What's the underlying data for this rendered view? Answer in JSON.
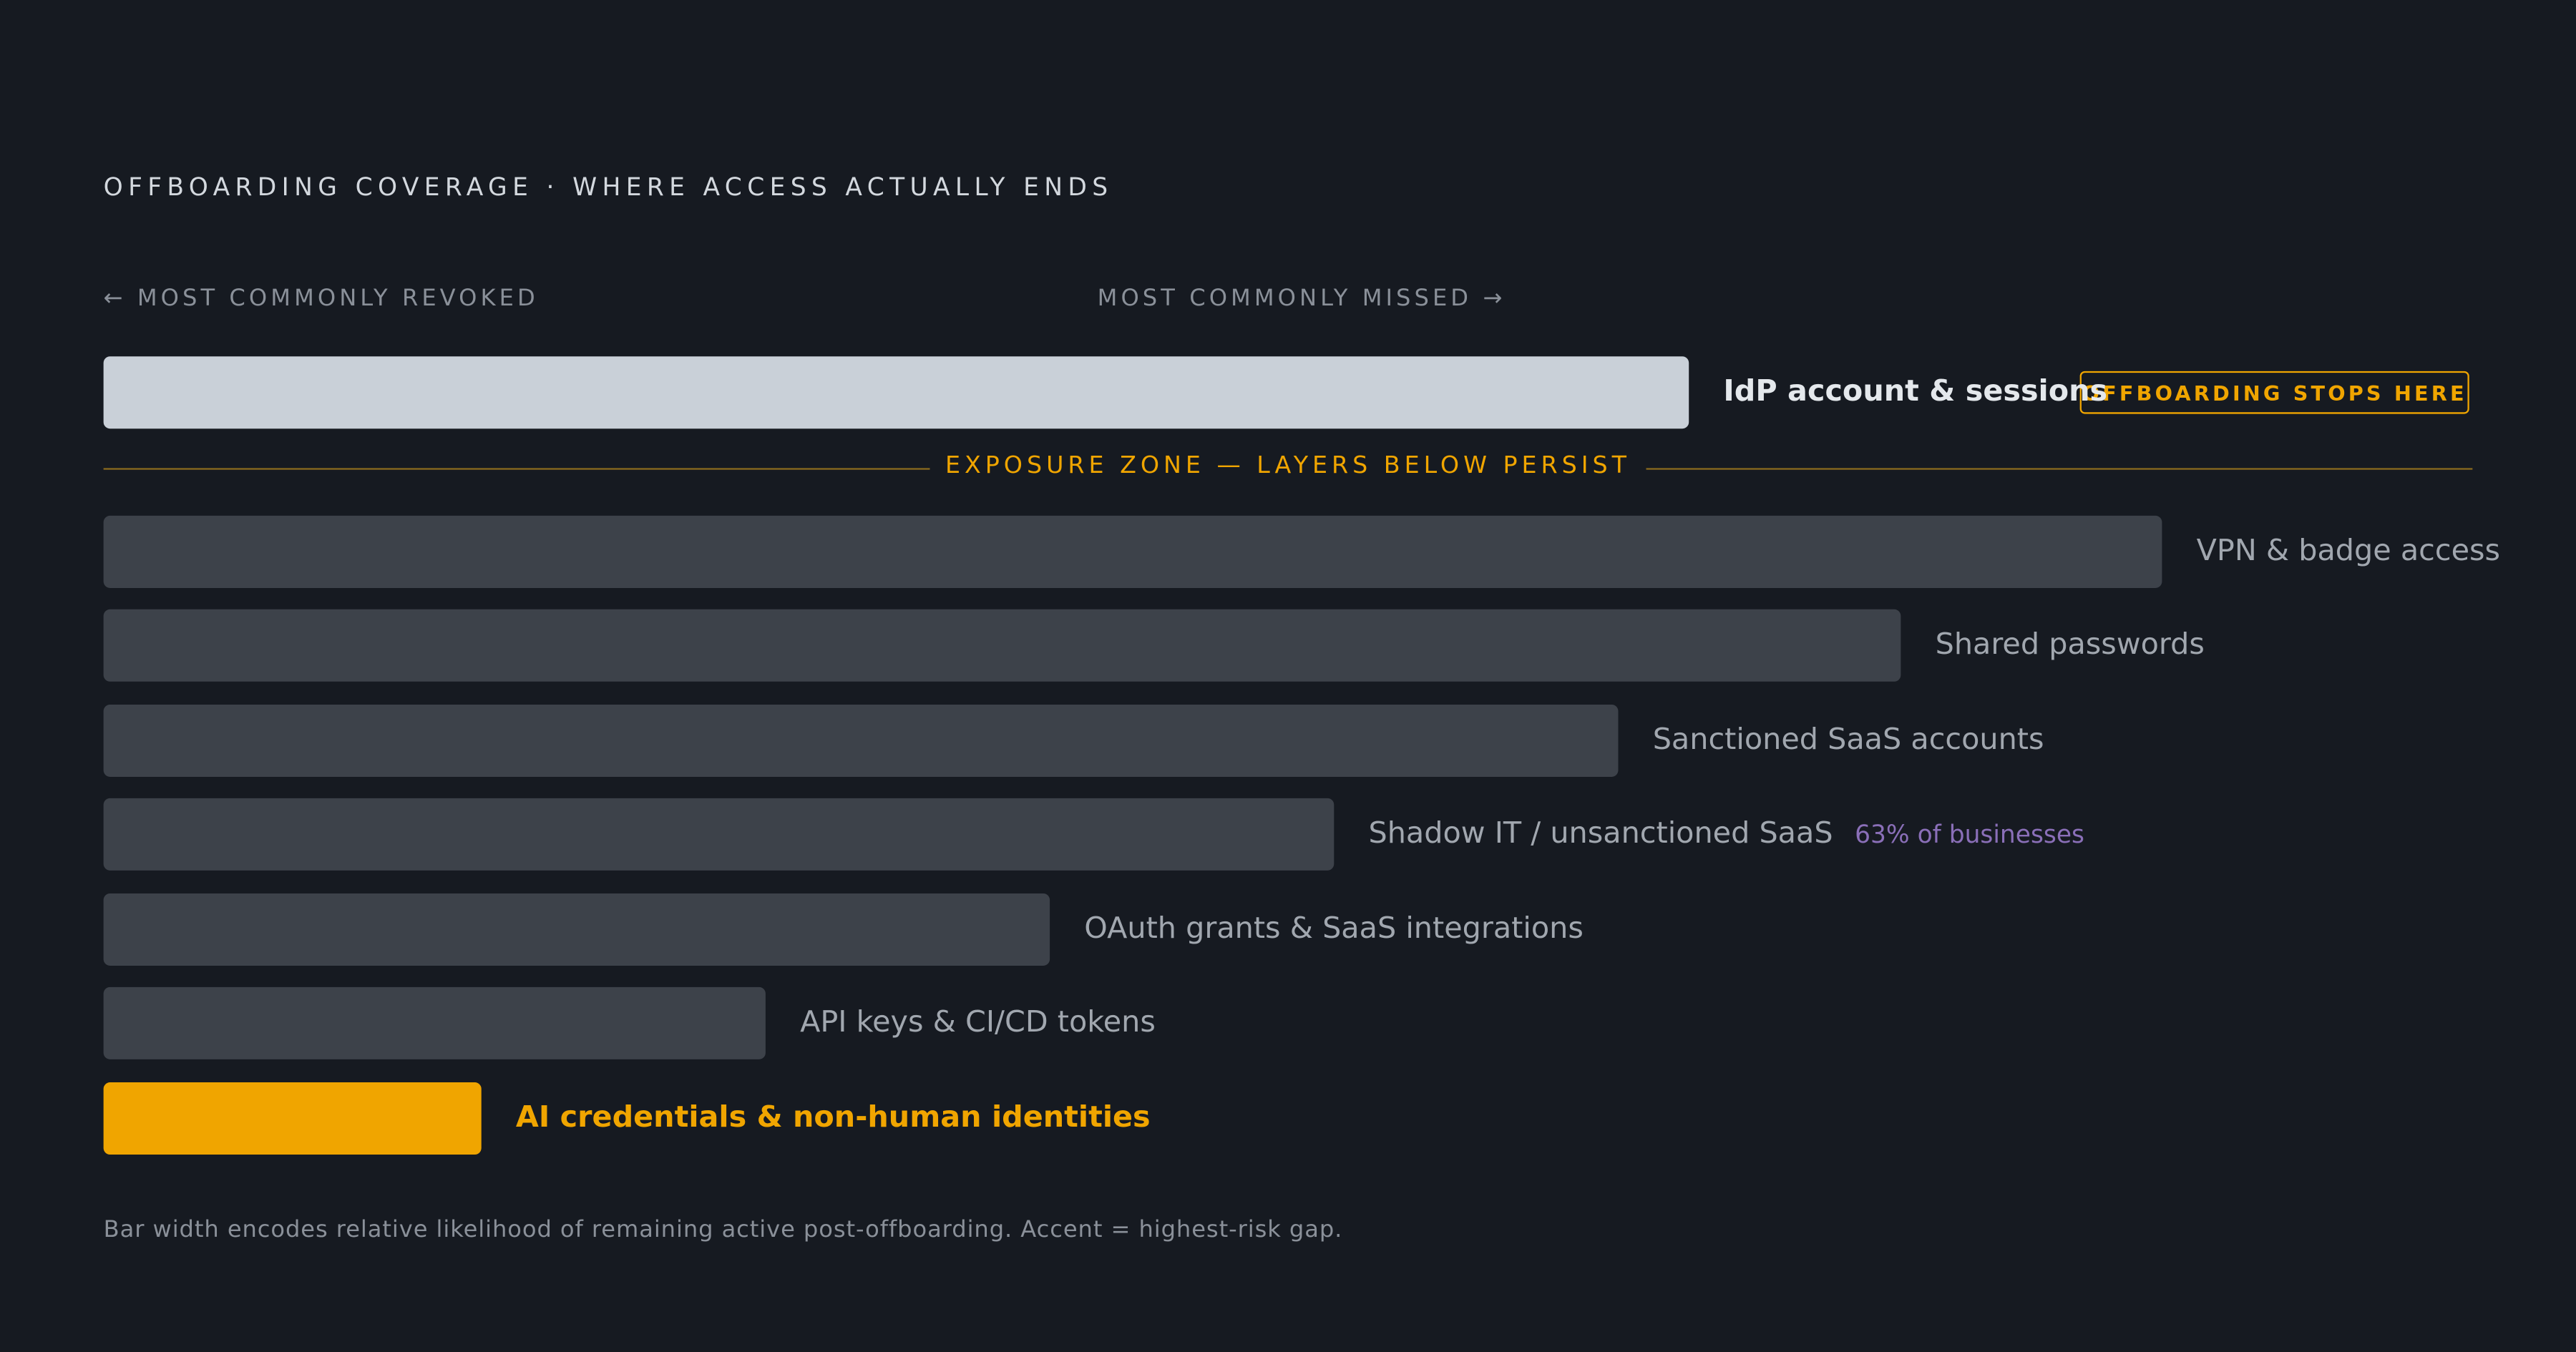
{
  "title": "OFFBOARDING COVERAGE · WHERE ACCESS ACTUALLY ENDS",
  "direction": {
    "left": "← MOST COMMONLY REVOKED",
    "right": "MOST COMMONLY MISSED →"
  },
  "badge": "OFFBOARDING STOPS HERE",
  "zone_label": "EXPOSURE ZONE — LAYERS BELOW PERSIST",
  "footnote": "Bar width encodes relative likelihood of remaining active post-offboarding. Accent = highest-risk gap.",
  "colors": {
    "background": "#161a21",
    "primary_bar": "#c9d0d8",
    "muted_bar": "#3d424a",
    "accent": "#f0a500",
    "note": "#8a6fb8"
  },
  "chart_data": {
    "type": "bar",
    "orientation": "horizontal",
    "categories": [
      "IdP account & sessions",
      "VPN & badge access",
      "Shared passwords",
      "Sanctioned SaaS accounts",
      "Shadow IT / unsanctioned SaaS",
      "OAuth grants & SaaS integrations",
      "API keys & CI/CD tokens",
      "AI credentials & non-human identities"
    ],
    "values": [
      67,
      87,
      76,
      64,
      52,
      40,
      28,
      16
    ],
    "styles": [
      "primary",
      "muted",
      "muted",
      "muted",
      "muted",
      "muted",
      "muted",
      "accent"
    ],
    "annotations": [
      {
        "category": "Shadow IT / unsanctioned SaaS",
        "text": "63% of businesses"
      }
    ],
    "title": "OFFBOARDING COVERAGE · WHERE ACCESS ACTUALLY ENDS",
    "xlabel": "",
    "ylabel": "",
    "xlim": [
      0,
      100
    ],
    "grid": false,
    "legend": "none"
  }
}
